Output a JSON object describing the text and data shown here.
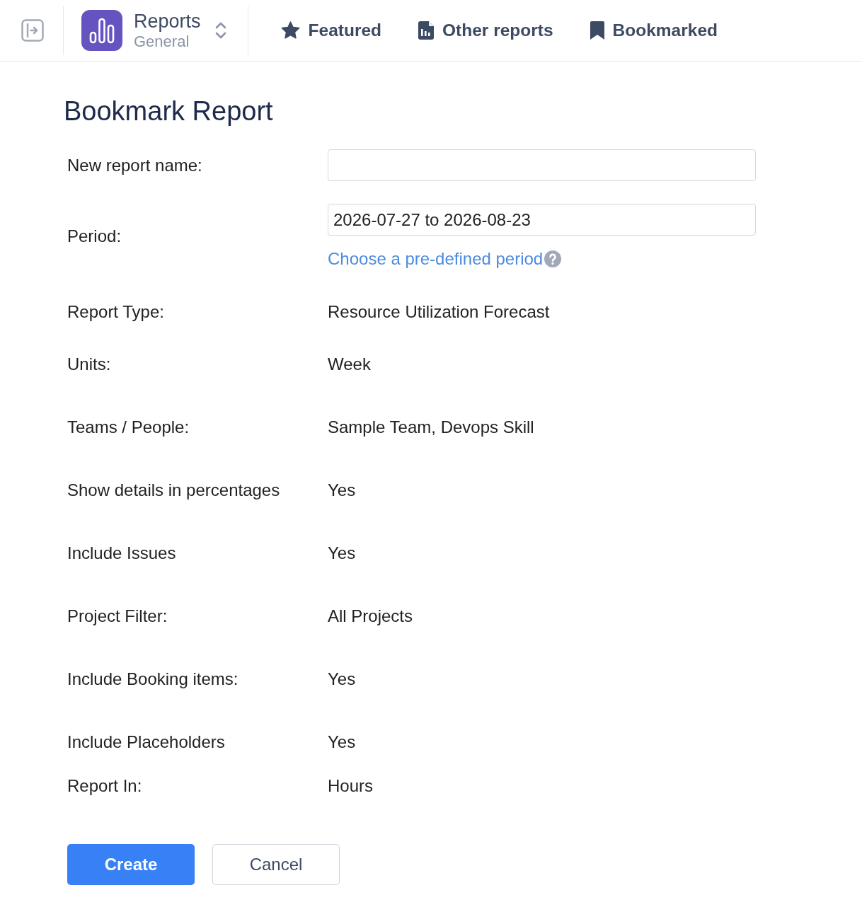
{
  "header": {
    "app": {
      "title": "Reports",
      "subtitle": "General"
    },
    "nav": [
      {
        "kind": "star",
        "label": "Featured",
        "selected": false
      },
      {
        "kind": "report",
        "label": "Other reports",
        "selected": false
      },
      {
        "kind": "bookmark",
        "label": "Bookmarked",
        "selected": false
      }
    ]
  },
  "page": {
    "title": "Bookmark Report",
    "inputs": [
      {
        "label": "New report name:"
      },
      {
        "label": "Period:",
        "value": "2026-07-27 to 2026-08-23",
        "link": "Choose a pre-defined period"
      }
    ],
    "details": [
      {
        "label": "Report Type:",
        "value": "Resource Utilization Forecast"
      },
      {
        "label": "Units:",
        "value": "Week"
      },
      {
        "label": "Teams / People:",
        "value": "Sample Team, Devops Skill"
      },
      {
        "label": "Show details in percentages",
        "value": "Yes"
      },
      {
        "label": "Include Issues",
        "value": "Yes"
      },
      {
        "label": "Project Filter:",
        "value": "All Projects"
      },
      {
        "label": "Include Booking items:",
        "value": "Yes"
      },
      {
        "label": "Include Placeholders",
        "value": "Yes"
      },
      {
        "label": "Report In:",
        "value": "Hours"
      }
    ],
    "buttons": [
      {
        "kind": "primary",
        "label": "Create"
      },
      {
        "kind": "secondary",
        "label": "Cancel"
      }
    ]
  }
}
